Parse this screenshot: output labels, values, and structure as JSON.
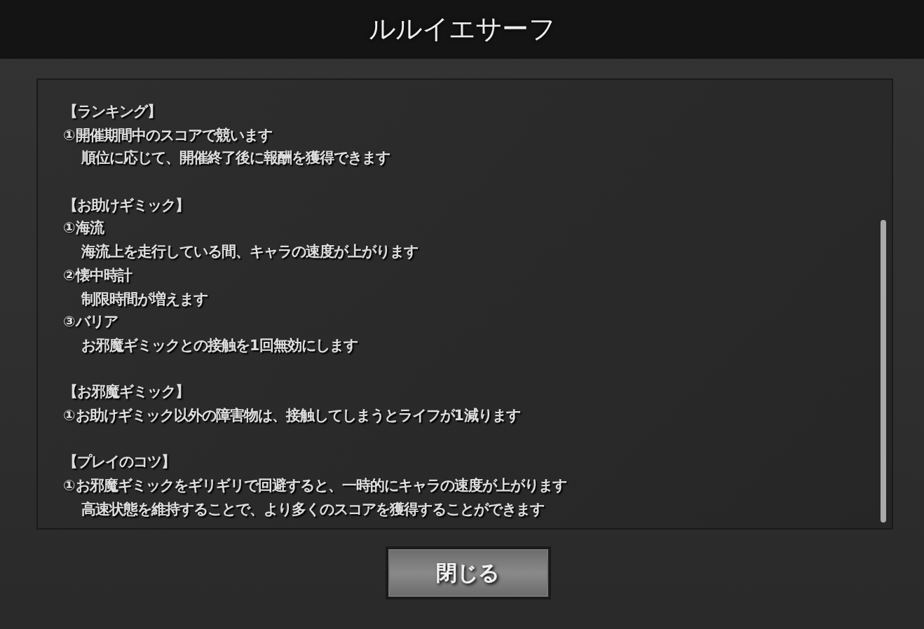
{
  "title": "ルルイエサーフ",
  "sections": [
    {
      "heading": "【ランキング】",
      "lines": [
        {
          "kind": "item",
          "text": "①開催期間中のスコアで競います"
        },
        {
          "kind": "detail",
          "text": "順位に応じて、開催終了後に報酬を獲得できます"
        }
      ]
    },
    {
      "heading": "【お助けギミック】",
      "lines": [
        {
          "kind": "item",
          "text": "①海流"
        },
        {
          "kind": "detail",
          "text": "海流上を走行している間、キャラの速度が上がります"
        },
        {
          "kind": "item",
          "text": "②懐中時計"
        },
        {
          "kind": "detail",
          "text": "制限時間が増えます"
        },
        {
          "kind": "item",
          "text": "③バリア"
        },
        {
          "kind": "detail",
          "text": "お邪魔ギミックとの接触を1回無効にします"
        }
      ]
    },
    {
      "heading": "【お邪魔ギミック】",
      "lines": [
        {
          "kind": "item",
          "text": "①お助けギミック以外の障害物は、接触してしまうとライフが1減ります"
        }
      ]
    },
    {
      "heading": "【プレイのコツ】",
      "lines": [
        {
          "kind": "item",
          "text": "①お邪魔ギミックをギリギリで回避すると、一時的にキャラの速度が上がります"
        },
        {
          "kind": "detail",
          "text": "高速状態を維持することで、より多くのスコアを獲得することができます"
        }
      ]
    }
  ],
  "close_button": "閉じる"
}
